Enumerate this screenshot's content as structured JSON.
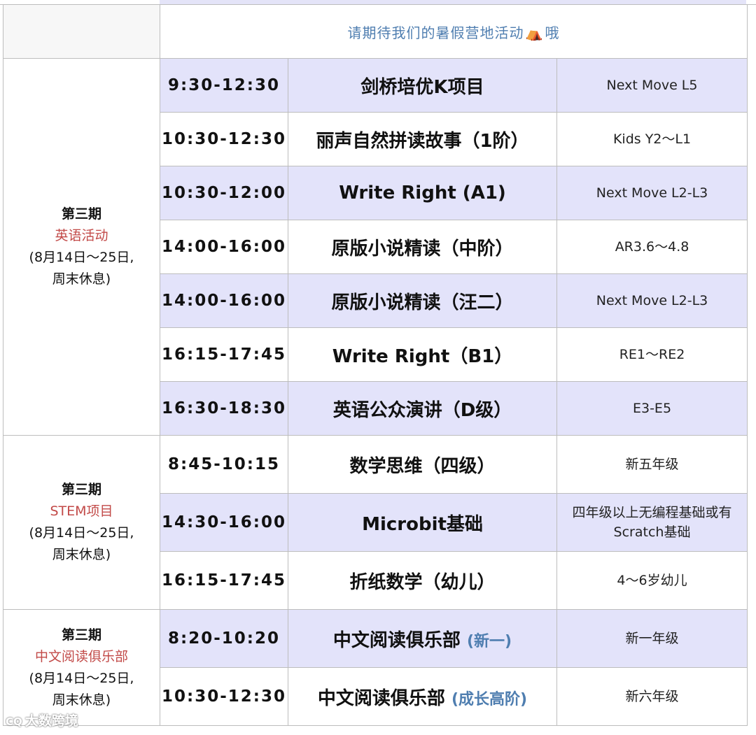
{
  "notice": {
    "text_before": "请期待我们的暑假营地活动",
    "tent_icon": "⛺",
    "text_after": "哦"
  },
  "sections": [
    {
      "period": "第三期",
      "name": "英语活动",
      "dates_line1": "(8月14日～25日,",
      "dates_line2": "周末休息)",
      "name_color": "#c24a48"
    },
    {
      "period": "第三期",
      "name": "STEM项目",
      "dates_line1": "(8月14日～25日,",
      "dates_line2": "周末休息)",
      "name_color": "#c24a48"
    },
    {
      "period": "第三期",
      "name": "中文阅读俱乐部",
      "dates_line1": "(8月14日～25日,",
      "dates_line2": "周末休息)",
      "name_color": "#c24a48"
    }
  ],
  "rows": [
    {
      "time": "9:30-12:30",
      "course": "剑桥培优K项目",
      "course_suffix": "",
      "level": "Next Move L5"
    },
    {
      "time": "10:30-12:30",
      "course": "丽声自然拼读故事（1阶）",
      "course_suffix": "",
      "level": "Kids Y2～L1"
    },
    {
      "time": "10:30-12:00",
      "course": "Write Right (A1)",
      "course_suffix": "",
      "level": "Next Move L2-L3"
    },
    {
      "time": "14:00-16:00",
      "course": "原版小说精读（中阶）",
      "course_suffix": "",
      "level": "AR3.6～4.8"
    },
    {
      "time": "14:00-16:00",
      "course": "原版小说精读（汪二）",
      "course_suffix": "",
      "level": "Next Move L2-L3"
    },
    {
      "time": "16:15-17:45",
      "course": "Write Right（B1）",
      "course_suffix": "",
      "level": "RE1～RE2"
    },
    {
      "time": "16:30-18:30",
      "course": "英语公众演讲（D级）",
      "course_suffix": "",
      "level": "E3-E5"
    },
    {
      "time": "8:45-10:15",
      "course": "数学思维（四级）",
      "course_suffix": "",
      "level": "新五年级"
    },
    {
      "time": "14:30-16:00",
      "course": "Microbit基础",
      "course_suffix": "",
      "level_line1": "四年级以上无编程基础或有",
      "level_line2": "Scratch基础"
    },
    {
      "time": "16:15-17:45",
      "course": "折纸数学（幼儿）",
      "course_suffix": "",
      "level": "4～6岁幼儿"
    },
    {
      "time": "8:20-10:20",
      "course": "中文阅读俱乐部",
      "course_suffix": "(新一)",
      "level": "新一年级"
    },
    {
      "time": "10:30-12:30",
      "course": "中文阅读俱乐部",
      "course_suffix": "(成长高阶)",
      "level": "新六年级"
    }
  ],
  "colors": {
    "row_shade": "#e3e3fa",
    "notice_text": "#4f7eb0",
    "section_name": "#c24a48",
    "suffix_blue": "#4f7eb0"
  },
  "watermark": {
    "icon": "CQ",
    "text": "大数跨境"
  }
}
